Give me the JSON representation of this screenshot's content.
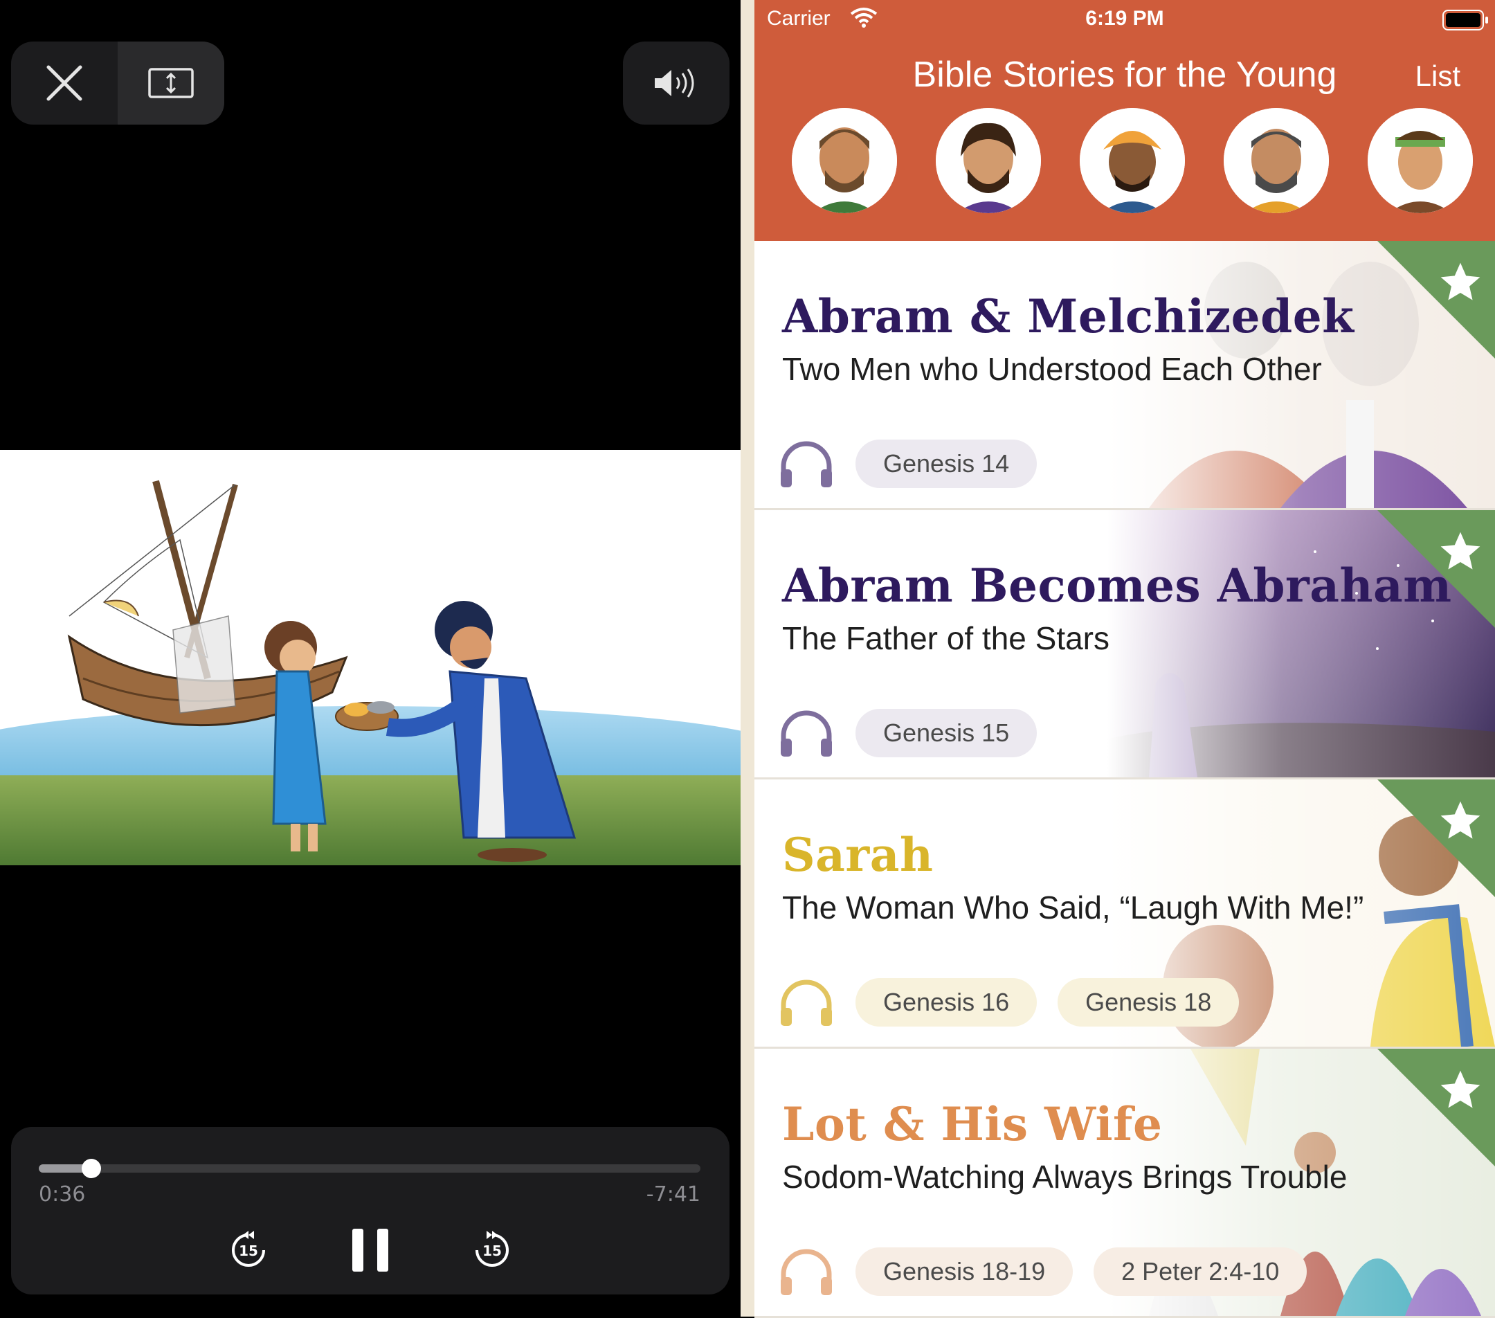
{
  "player": {
    "current_time": "0:36",
    "remaining_time": "-7:41",
    "progress": 0.08,
    "icons": {
      "close": "close-icon",
      "resize": "resize-icon",
      "volume": "volume-icon",
      "rewind": "rewind-15-icon",
      "pause": "pause-icon",
      "forward": "forward-15-icon"
    },
    "skip_seconds": "15"
  },
  "status": {
    "carrier": "Carrier",
    "time": "6:19 PM"
  },
  "header": {
    "title": "Bible Stories for the Young",
    "list_label": "List",
    "avatar_count": 5
  },
  "stories": [
    {
      "title": "Abram & Melchizedek",
      "subtitle": "Two Men who Understood Each Other",
      "title_color": "#2e1a5e",
      "accent": "#7e6e9d",
      "pill_bg": "#ece9f0",
      "references": [
        "Genesis 14"
      ]
    },
    {
      "title": "Abram Becomes Abraham",
      "subtitle": "The Father of the Stars",
      "title_color": "#2e1a5e",
      "accent": "#7e6e9d",
      "pill_bg": "#ece9f0",
      "references": [
        "Genesis 15"
      ]
    },
    {
      "title": "Sarah",
      "subtitle": "The Woman Who Said, “Laugh With Me!”",
      "title_color": "#d9b52a",
      "accent": "#e2c460",
      "pill_bg": "#f8f2dc",
      "references": [
        "Genesis 16",
        "Genesis 18"
      ]
    },
    {
      "title": "Lot & His Wife",
      "subtitle": "Sodom-Watching Always Brings Trouble",
      "title_color": "#df8d4f",
      "accent": "#e9b48e",
      "pill_bg": "#f7ede4",
      "references": [
        "Genesis 18-19",
        "2 Peter 2:4-10"
      ]
    }
  ]
}
